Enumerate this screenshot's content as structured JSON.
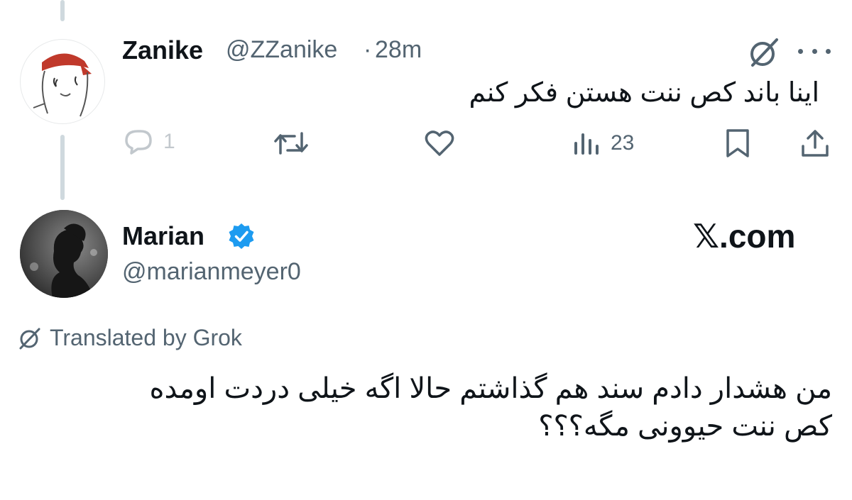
{
  "tweet_reply": {
    "display_name": "Zanike",
    "handle": "@ZZanike",
    "separator": "·",
    "time": "28m",
    "text": "اینا باند کص ننت هستن فکر کنم",
    "reply_count": "1",
    "views_count": "23"
  },
  "tweet_main": {
    "display_name": "Marian",
    "handle": "@marianmeyer0",
    "site_logo": "𝕏.com",
    "translated_label": "Translated by Grok",
    "text_line1": "من هشدار دادم سند هم گذاشتم حالا اگه خیلی دردت اومده",
    "text_line2": "کص ننت حیوونی مگه؟؟؟"
  },
  "icons": [
    "grok-icon",
    "more-icon",
    "reply-icon",
    "retweet-icon",
    "like-icon",
    "views-icon",
    "bookmark-icon",
    "share-icon",
    "verified-badge-icon"
  ],
  "colors": {
    "text": "#0f1419",
    "secondary": "#536471",
    "verified": "#1d9bf0",
    "thread_line": "#cfd9de"
  }
}
